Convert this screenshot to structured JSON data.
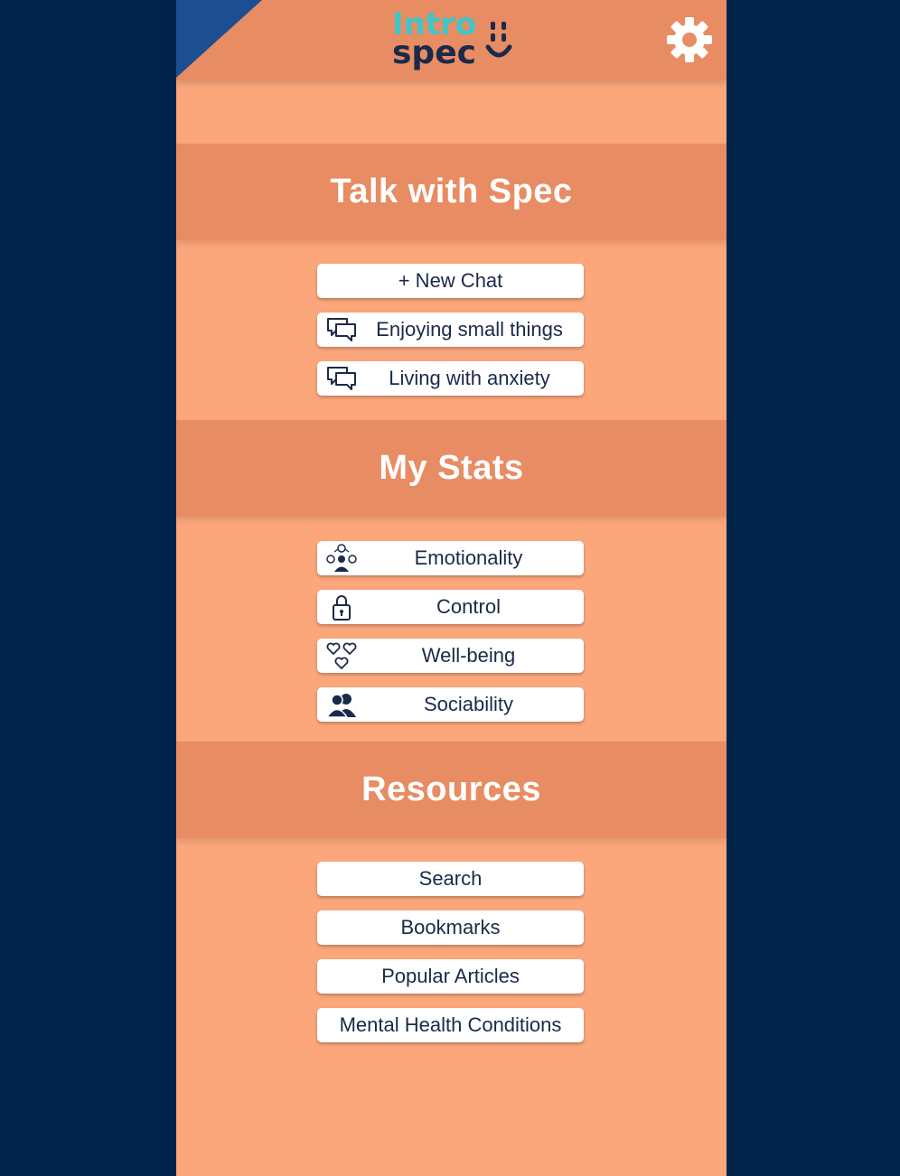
{
  "app": {
    "logo_text_top": "Intro",
    "logo_text_bottom": "spec",
    "settings_icon": "gear-icon"
  },
  "colors": {
    "background": "#00234a",
    "panel": "#fba67b",
    "header": "#e88c63",
    "corner": "#1d4e92",
    "logo_top": "#3fc6c9",
    "logo_bottom": "#1a2a4a",
    "button_text": "#1a2a4a"
  },
  "sections": {
    "talk": {
      "title": "Talk with Spec",
      "new_chat": "+ New Chat",
      "chats": [
        {
          "label": "Enjoying small things",
          "icon": "chat-bubbles-icon"
        },
        {
          "label": "Living with anxiety",
          "icon": "chat-bubbles-icon"
        }
      ]
    },
    "stats": {
      "title": "My Stats",
      "items": [
        {
          "label": "Emotionality",
          "icon": "emotions-icon"
        },
        {
          "label": "Control",
          "icon": "lock-icon"
        },
        {
          "label": "Well-being",
          "icon": "hearts-icon"
        },
        {
          "label": "Sociability",
          "icon": "people-icon"
        }
      ]
    },
    "resources": {
      "title": "Resources",
      "items": [
        {
          "label": "Search"
        },
        {
          "label": "Bookmarks"
        },
        {
          "label": "Popular Articles"
        },
        {
          "label": "Mental Health Conditions"
        }
      ]
    }
  }
}
